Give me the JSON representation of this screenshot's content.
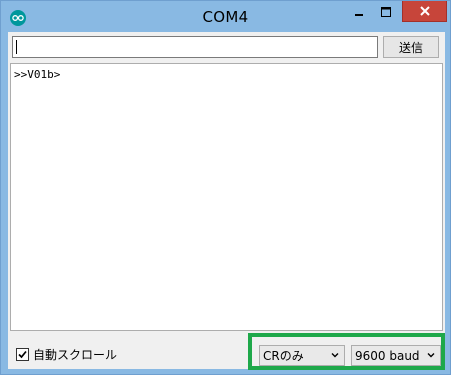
{
  "window": {
    "title": "COM4",
    "app_icon": "arduino-icon",
    "controls": [
      "minimize-icon",
      "maximize-icon",
      "close-icon"
    ],
    "close_color": "#c7453a"
  },
  "send": {
    "input_value": "",
    "button_label": "送信"
  },
  "output": {
    "lines": [
      ">>V01b>"
    ]
  },
  "footer": {
    "autoscroll_label": "自動スクロール",
    "autoscroll_checked": true,
    "line_ending": "CRのみ",
    "baud_rate": "9600 baud",
    "highlight_color": "#1ea84a"
  }
}
